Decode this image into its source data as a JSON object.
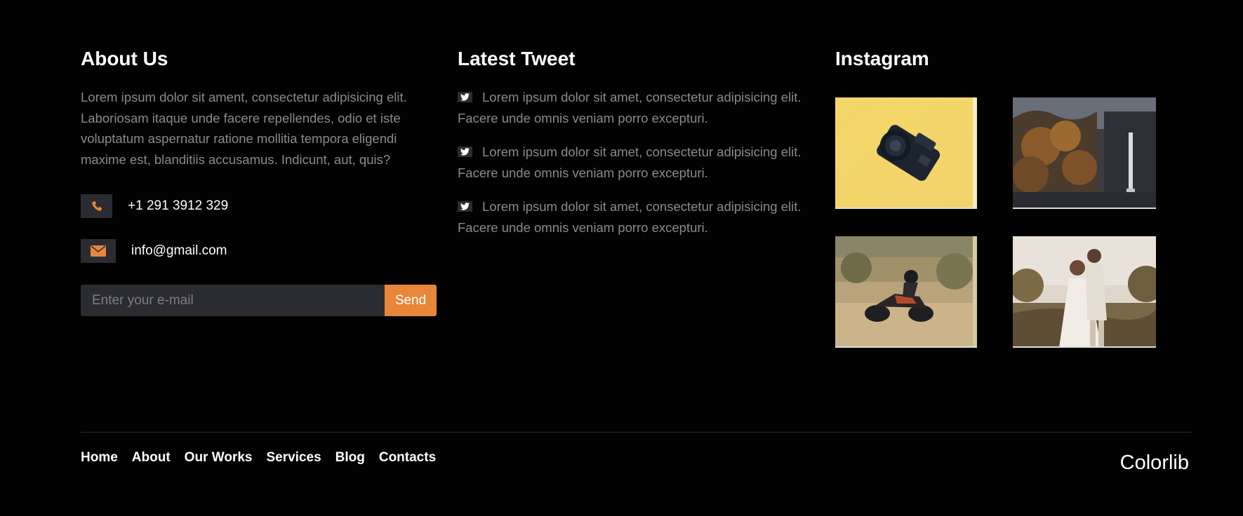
{
  "about": {
    "heading": "About Us",
    "text": "Lorem ipsum dolor sit ament, consectetur adipisicing elit. Laboriosam itaque unde facere repellendes, odio et iste voluptatum aspernatur ratione mollitia tempora eligendi maxime est, blanditiis accusamus. Indicunt, aut, quis?",
    "phone": "+1 291 3912 329",
    "email": "info@gmail.com",
    "subscribe": {
      "placeholder": "Enter your e-mail",
      "button_label": "Send"
    }
  },
  "tweets": {
    "heading": "Latest Tweet",
    "items": [
      {
        "text": "Lorem ipsum dolor sit amet, consectetur adipisicing elit. Facere unde omnis veniam porro excepturi."
      },
      {
        "text": "Lorem ipsum dolor sit amet, consectetur adipisicing elit. Facere unde omnis veniam porro excepturi."
      },
      {
        "text": "Lorem ipsum dolor sit amet, consectetur adipisicing elit. Facere unde omnis veniam porro excepturi."
      }
    ]
  },
  "instagram": {
    "heading": "Instagram",
    "images": [
      {
        "subject": "camera-on-yellow"
      },
      {
        "subject": "waterfall-forest"
      },
      {
        "subject": "motorcycle-rider"
      },
      {
        "subject": "couple-in-field"
      }
    ]
  },
  "footer_nav": {
    "items": [
      {
        "label": "Home"
      },
      {
        "label": "About"
      },
      {
        "label": "Our Works"
      },
      {
        "label": "Services"
      },
      {
        "label": "Blog"
      },
      {
        "label": "Contacts"
      }
    ]
  },
  "brand": "Colorlib",
  "colors": {
    "background": "#020202",
    "accent": "#e8873a",
    "panel": "#2b2c31",
    "muted_text": "#8a8a8a"
  },
  "icons": {
    "phone": "phone-icon",
    "email": "envelope-icon",
    "tweet": "twitter-icon"
  }
}
